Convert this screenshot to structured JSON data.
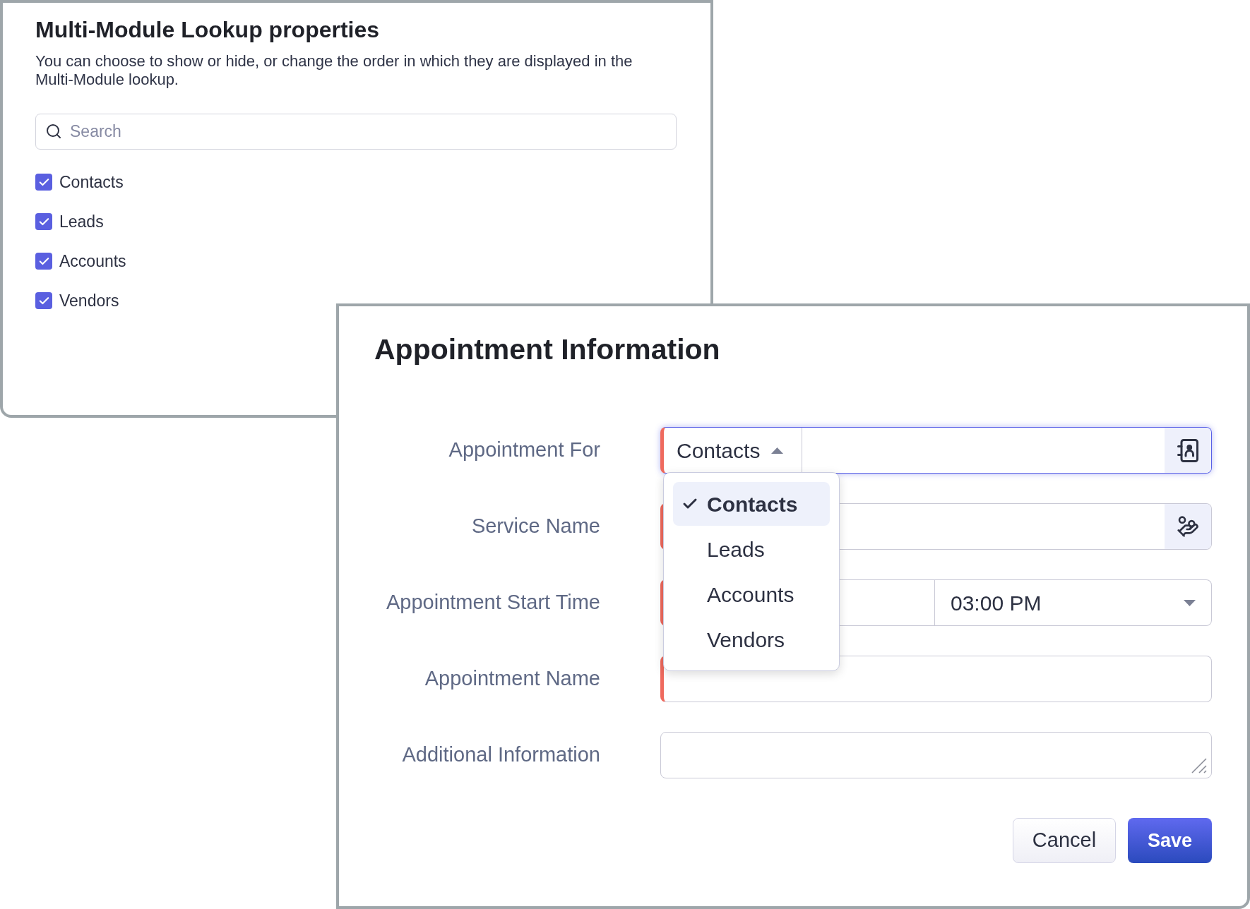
{
  "lookup_panel": {
    "title": "Multi-Module Lookup properties",
    "description": "You can choose to show or hide, or change the order in which they are displayed in the Multi-Module lookup.",
    "search": {
      "placeholder": "Search"
    },
    "modules": [
      {
        "label": "Contacts",
        "checked": true
      },
      {
        "label": "Leads",
        "checked": true
      },
      {
        "label": "Accounts",
        "checked": true
      },
      {
        "label": "Vendors",
        "checked": true
      }
    ]
  },
  "appointment_form": {
    "title": "Appointment Information",
    "fields": [
      {
        "kind": "module_lookup",
        "label": "Appointment For",
        "required": true,
        "focused": true,
        "module": {
          "value": "Contacts",
          "expanded": true,
          "options": [
            {
              "label": "Contacts",
              "selected": true
            },
            {
              "label": "Leads",
              "selected": false
            },
            {
              "label": "Accounts",
              "selected": false
            },
            {
              "label": "Vendors",
              "selected": false
            }
          ]
        }
      },
      {
        "kind": "lookup",
        "label": "Service Name",
        "required": true,
        "focused": false
      },
      {
        "kind": "datetime",
        "label": "Appointment Start Time",
        "required": true,
        "focused": false,
        "time": "03:00 PM"
      },
      {
        "kind": "text",
        "label": "Appointment Name",
        "required": true,
        "focused": false
      },
      {
        "kind": "textarea",
        "label": "Additional Information",
        "required": false,
        "focused": false
      }
    ],
    "buttons": [
      {
        "label": "Cancel",
        "kind": "secondary"
      },
      {
        "label": "Save",
        "kind": "primary"
      }
    ]
  }
}
